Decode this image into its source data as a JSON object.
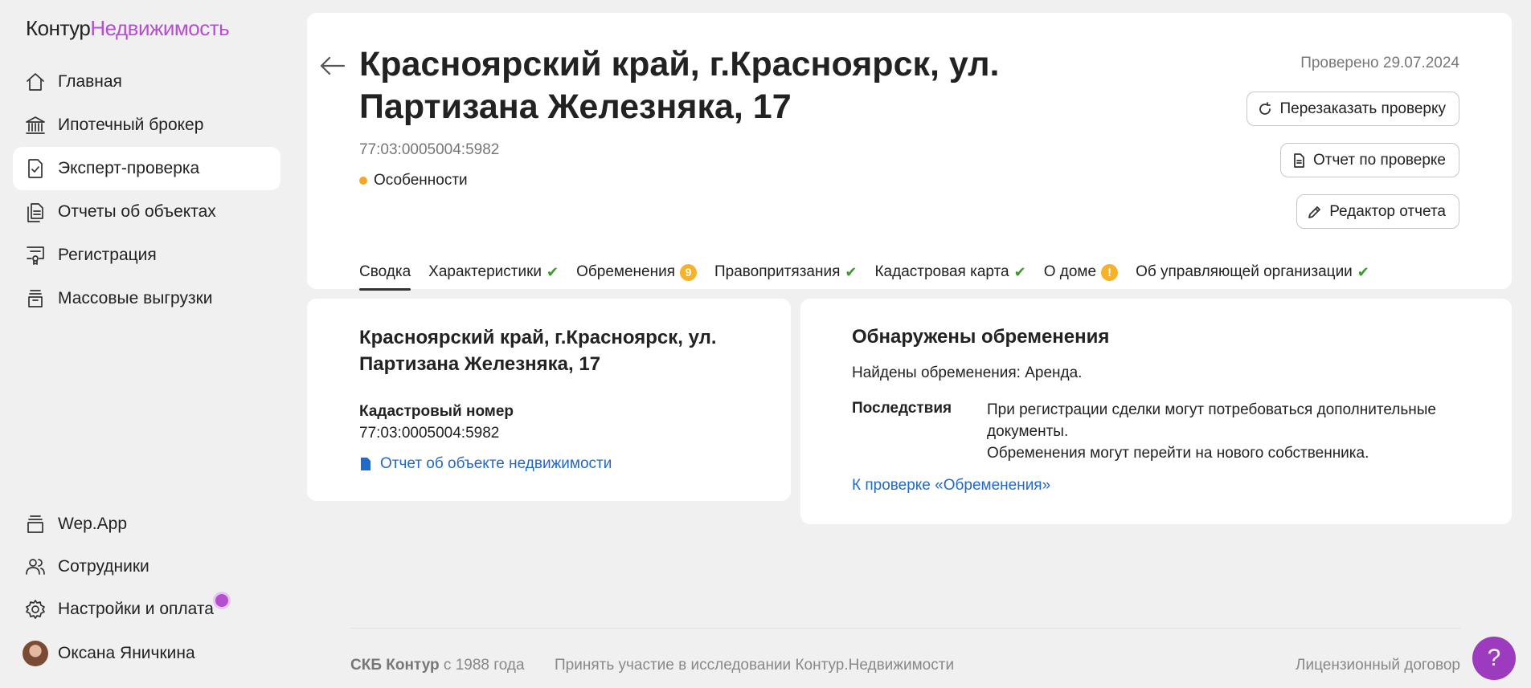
{
  "logo": {
    "brand": "Контур",
    "product": "Недвижимость"
  },
  "sidebar": {
    "items": [
      {
        "label": "Главная",
        "icon": "home-icon"
      },
      {
        "label": "Ипотечный брокер",
        "icon": "bank-icon"
      },
      {
        "label": "Эксперт-проверка",
        "icon": "document-check-icon",
        "active": true
      },
      {
        "label": "Отчеты об объектах",
        "icon": "documents-icon"
      },
      {
        "label": "Регистрация",
        "icon": "certificate-icon"
      },
      {
        "label": "Массовые выгрузки",
        "icon": "archive-icon"
      }
    ],
    "bottom": [
      {
        "label": "Wep.App",
        "icon": "layers-icon"
      },
      {
        "label": "Сотрудники",
        "icon": "users-icon"
      },
      {
        "label": "Настройки и оплата",
        "icon": "gear-icon"
      },
      {
        "label": "Оксана Яничкина",
        "icon": "avatar"
      }
    ]
  },
  "header": {
    "title": "Красноярский край, г.Красноярск, ул. Партизана Железняка, 17",
    "cadastral_number": "77:03:0005004:5982",
    "feature_label": "Особенности",
    "checked_date": "Проверено 29.07.2024",
    "buttons": {
      "reorder": "Перезаказать проверку",
      "report": "Отчет по проверке",
      "editor": "Редактор отчета"
    },
    "tabs": [
      {
        "label": "Сводка",
        "status": "active"
      },
      {
        "label": "Характеристики",
        "status": "ok"
      },
      {
        "label": "Обременения",
        "status": "badge",
        "badge": "9"
      },
      {
        "label": "Правопритязания",
        "status": "ok"
      },
      {
        "label": "Кадастровая карта",
        "status": "ok"
      },
      {
        "label": "О доме",
        "status": "warning",
        "badge": "!"
      },
      {
        "label": "Об управляющей организации",
        "status": "ok"
      }
    ]
  },
  "summary": {
    "title": "Красноярский край, г.Красноярск, ул. Партизана Железняка, 17",
    "cadastral_label": "Кадастровый номер",
    "cadastral_number": "77:03:0005004:5982",
    "report_link": "Отчет об объекте недвижимости"
  },
  "encumbrances": {
    "title": "Обнаружены обременения",
    "found": "Найдены обременения: Аренда.",
    "consequences_label": "Последствия",
    "consequences_line1": "При регистрации сделки могут потребоваться дополнительные документы.",
    "consequences_line2": "Обременения могут перейти на нового собственника.",
    "link": "К проверке «Обременения»"
  },
  "footer": {
    "company": "СКБ Контур",
    "since": " с 1988 года",
    "research": "Принять участие в исследовании Контур.Недвижимости",
    "license": "Лицензионный договор"
  },
  "help": {
    "label": "?"
  },
  "colors": {
    "accent": "#b44fd0",
    "help": "#9c3bbd",
    "link": "#2369c8",
    "ok": "#3a9a2a",
    "warning": "#f5b22a"
  }
}
